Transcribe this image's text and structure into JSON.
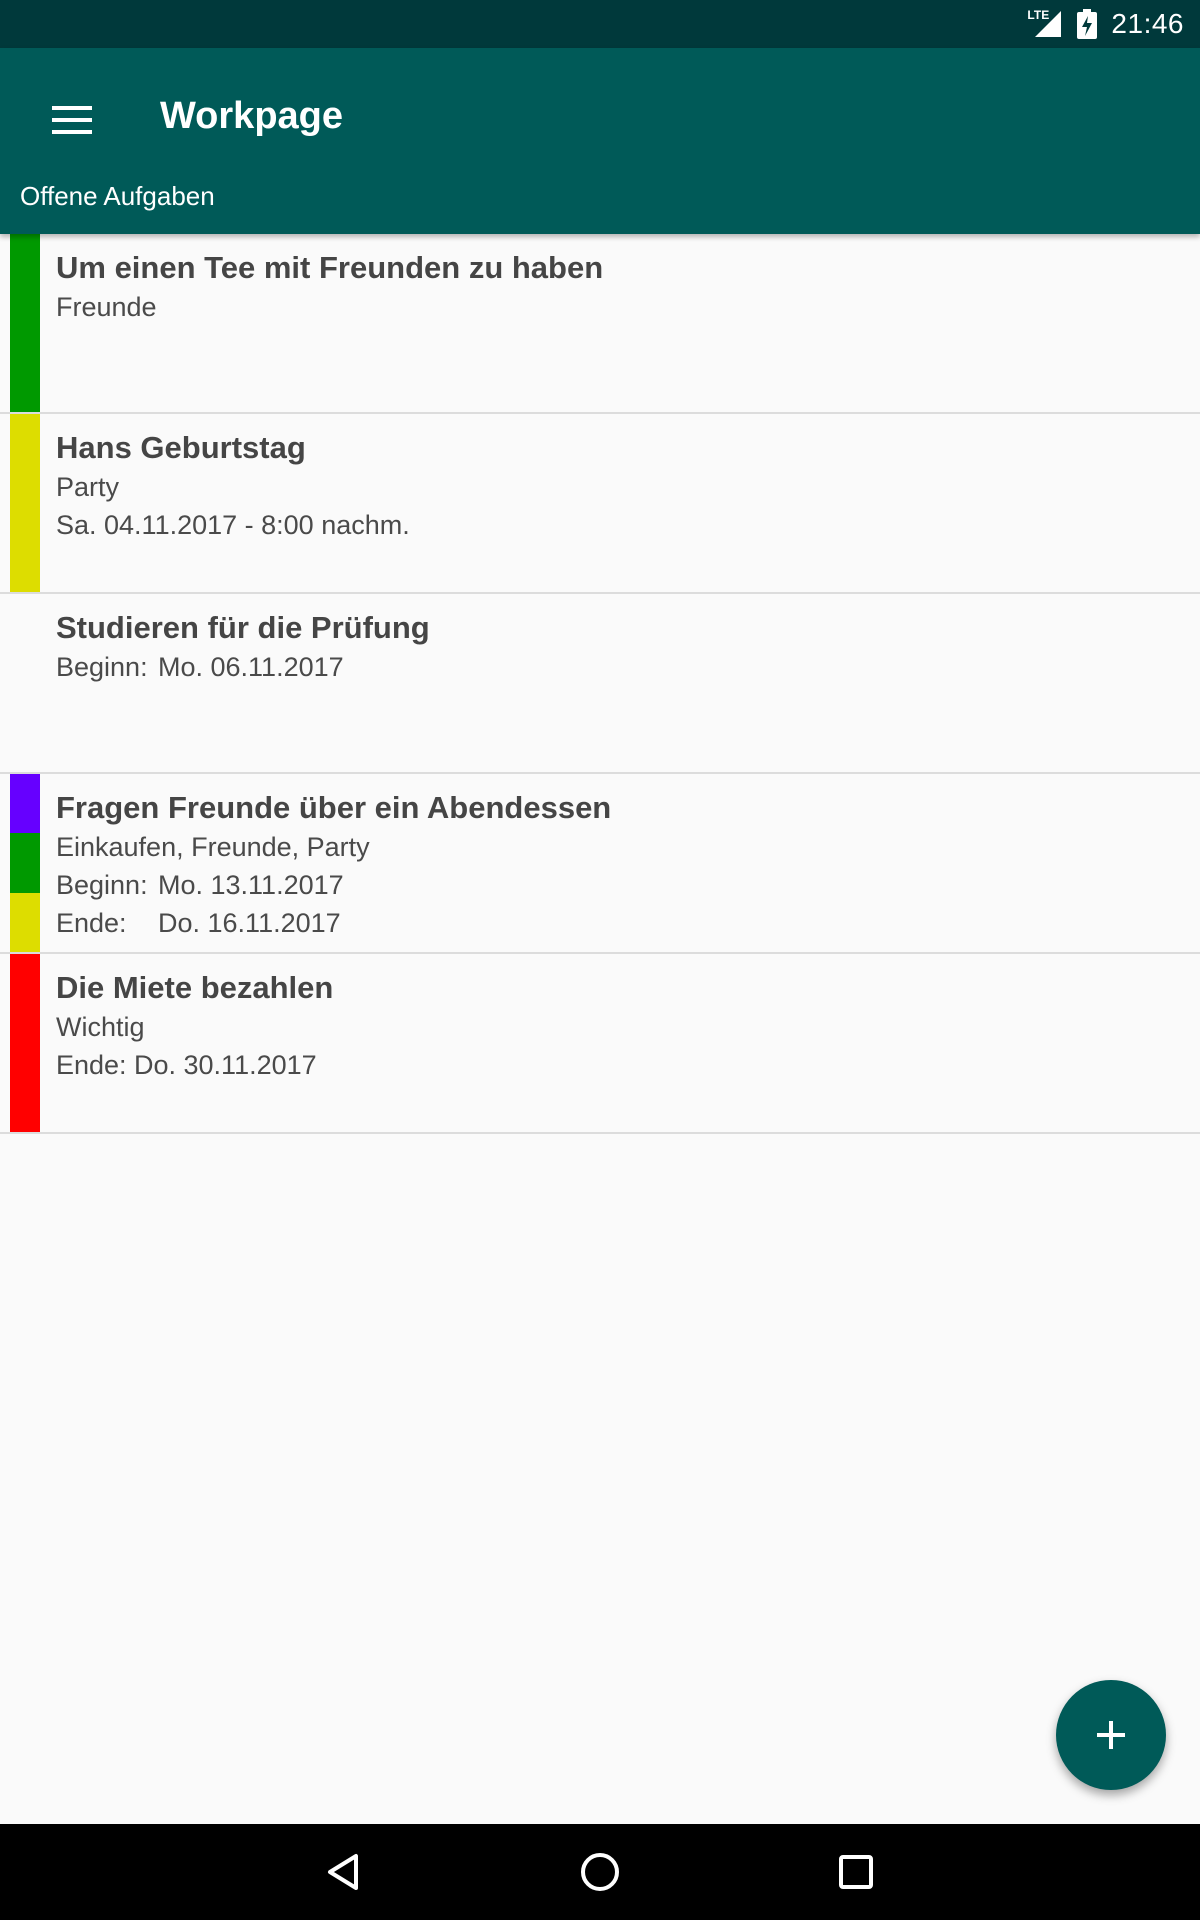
{
  "status_bar": {
    "network": "LTE",
    "time": "21:46"
  },
  "app_bar": {
    "title": "Workpage",
    "subtitle": "Offene Aufgaben",
    "menu_icon": "hamburger-menu-icon"
  },
  "tasks": [
    {
      "title": "Um einen Tee mit Freunden zu haben",
      "categories": "Freunde",
      "colors": [
        "#009900"
      ]
    },
    {
      "title": "Hans Geburtstag",
      "categories": "Party",
      "date": "Sa. 04.11.2017 - 8:00 nachm.",
      "colors": [
        "#dddd00"
      ]
    },
    {
      "title": "Studieren für die Prüfung",
      "start_label": "Beginn:",
      "start_value": "Mo. 06.11.2017",
      "colors": []
    },
    {
      "title": "Fragen Freunde über ein Abendessen",
      "categories": "Einkaufen, Freunde, Party",
      "start_label": "Beginn:",
      "start_value": "Mo. 13.11.2017",
      "end_label": "Ende:",
      "end_value": "Do. 16.11.2017",
      "colors": [
        "#6600ff",
        "#009900",
        "#dddd00"
      ]
    },
    {
      "title": "Die Miete bezahlen",
      "categories": "Wichtig",
      "end_label": "Ende:",
      "end_value": "Do. 30.11.2017",
      "colors": [
        "#ff0000"
      ]
    }
  ],
  "fab": {
    "icon": "plus-icon",
    "color": "#005a58"
  },
  "nav_bar": {
    "back_icon": "back-triangle-icon",
    "home_icon": "home-circle-icon",
    "recents_icon": "recents-square-icon"
  },
  "colors": {
    "status_bar": "#00393b",
    "primary": "#005a58",
    "background": "#fafafa"
  }
}
